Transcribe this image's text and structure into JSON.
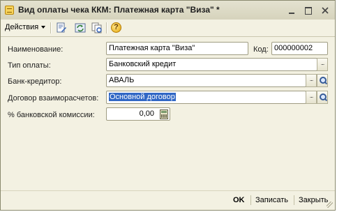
{
  "window": {
    "title": "Вид оплаты чека ККМ: Платежная карта \"Виза\" *"
  },
  "toolbar": {
    "actions_label": "Действия",
    "icons": [
      "edit-doc-icon",
      "refresh-icon",
      "copy-doc-icon",
      "help-icon"
    ],
    "help_glyph": "?"
  },
  "form": {
    "name_label": "Наименование:",
    "name_value": "Платежная карта \"Виза\"",
    "code_label": "Код:",
    "code_value": "000000002",
    "payment_type_label": "Тип оплаты:",
    "payment_type_value": "Банковский кредит",
    "bank_creditor_label": "Банк-кредитор:",
    "bank_creditor_value": "АВАЛЬ",
    "contract_label": "Договор взаиморасчетов:",
    "contract_value": "Основной договор",
    "commission_label": "% банковской комиссии:",
    "commission_value": "0,00",
    "select_button_glyph": "..."
  },
  "footer": {
    "ok_label": "OK",
    "save_label": "Записать",
    "close_label": "Закрыть"
  },
  "colors": {
    "window_bg": "#f3f1e2",
    "selection": "#3167c5"
  }
}
